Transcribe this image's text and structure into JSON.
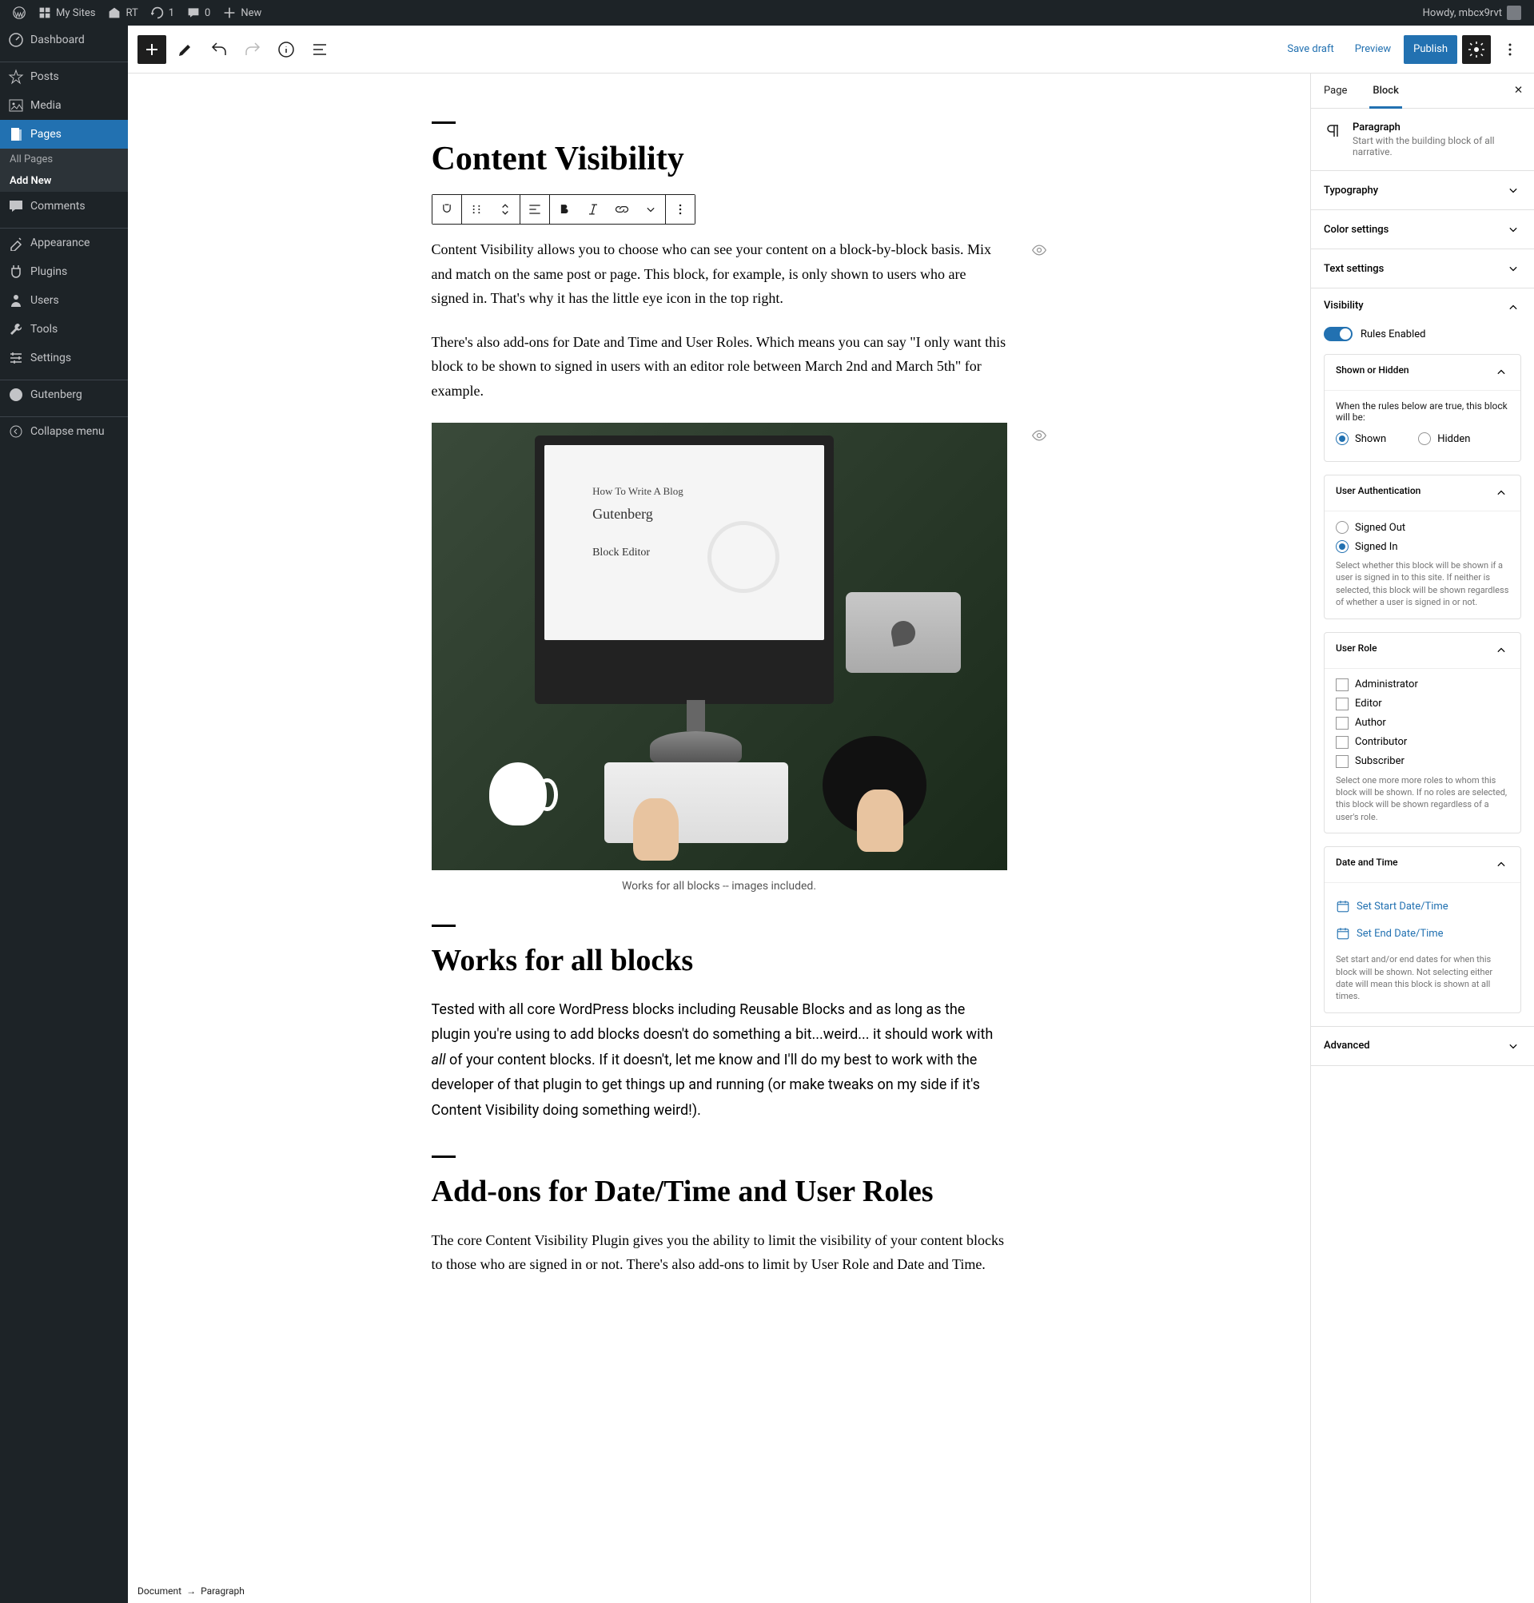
{
  "adminbar": {
    "mysites": "My Sites",
    "site": "RT",
    "updates": "1",
    "comments": "0",
    "new": "New",
    "howdy": "Howdy, mbcx9rvt"
  },
  "sidebar": {
    "items": [
      {
        "label": "Dashboard",
        "icon": "dashboard"
      },
      {
        "label": "Posts",
        "icon": "pin"
      },
      {
        "label": "Media",
        "icon": "media"
      },
      {
        "label": "Pages",
        "icon": "page",
        "current": true
      },
      {
        "label": "Comments",
        "icon": "comment"
      },
      {
        "label": "Appearance",
        "icon": "appearance"
      },
      {
        "label": "Plugins",
        "icon": "plugin"
      },
      {
        "label": "Users",
        "icon": "user"
      },
      {
        "label": "Tools",
        "icon": "tool"
      },
      {
        "label": "Settings",
        "icon": "settings"
      },
      {
        "label": "Gutenberg",
        "icon": "gutenberg"
      },
      {
        "label": "Collapse menu",
        "icon": "collapse"
      }
    ],
    "submenu": {
      "all": "All Pages",
      "addnew": "Add New"
    }
  },
  "header": {
    "savedraft": "Save draft",
    "preview": "Preview",
    "publish": "Publish"
  },
  "content": {
    "title": "Content Visibility",
    "p1": "Content Visibility allows you to choose who can see your content on a block-by-block basis. Mix and match on the same post or page. This block, for example, is only shown to users who are signed in. That's why it has the little eye icon in the top right.",
    "p2": "There's also add-ons for Date and Time and User Roles. Which means you can say \"I only want this block to be shown to signed in users with an editor role between March 2nd and March 5th\" for example.",
    "screen_h1": "How To Write A Blog",
    "screen_h2": "Gutenberg",
    "screen_h3": "Block Editor",
    "caption": "Works for all blocks -- images included.",
    "h2a": "Works for all blocks",
    "p3a": "Tested with all core WordPress blocks including Reusable Blocks and as long as the plugin you're using to add blocks doesn't do something a bit...weird... it should work with ",
    "p3em": "all",
    "p3b": " of your content blocks. If it doesn't, let me know and I'll do my best to work with the developer of that plugin to get things up and running (or make tweaks on my side if it's Content Visibility doing something weird!).",
    "h2b": "Add-ons for Date/Time and User Roles",
    "p4": "The core Content Visibility Plugin gives you the ability to limit the visibility of your content blocks to those who are signed in or not. There's also add-ons to limit by User Role and Date and Time."
  },
  "panel": {
    "tab_page": "Page",
    "tab_block": "Block",
    "block_type": "Paragraph",
    "block_desc": "Start with the building block of all narrative.",
    "typography": "Typography",
    "color": "Color settings",
    "text": "Text settings",
    "visibility": "Visibility",
    "rules_enabled": "Rules Enabled",
    "shown_hidden": "Shown or Hidden",
    "shown_hidden_desc": "When the rules below are true, this block will be:",
    "shown": "Shown",
    "hidden": "Hidden",
    "user_auth": "User Authentication",
    "signed_out": "Signed Out",
    "signed_in": "Signed In",
    "auth_help": "Select whether this block will be shown if a user is signed in to this site. If neither is selected, this block will be shown regardless of whether a user is signed in or not.",
    "user_role": "User Role",
    "roles": [
      "Administrator",
      "Editor",
      "Author",
      "Contributor",
      "Subscriber"
    ],
    "role_help": "Select one more more roles to whom this block will be shown. If no roles are selected, this block will be shown regardless of a user's role.",
    "date_time": "Date and Time",
    "set_start": "Set Start Date/Time",
    "set_end": "Set End Date/Time",
    "date_help": "Set start and/or end dates for when this block will be shown. Not selecting either date will mean this block is shown at all times.",
    "advanced": "Advanced"
  },
  "breadcrumb": {
    "doc": "Document",
    "block": "Paragraph"
  }
}
